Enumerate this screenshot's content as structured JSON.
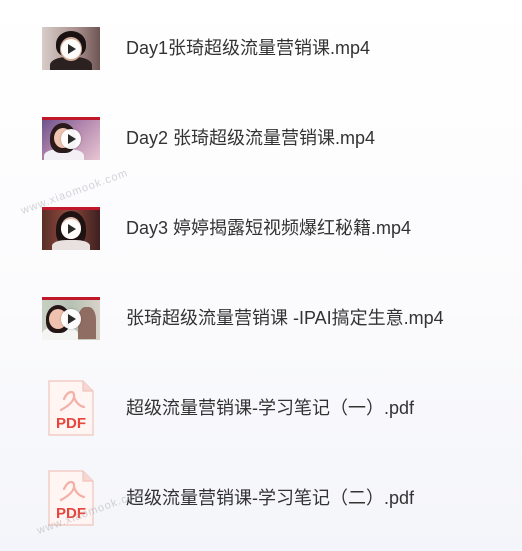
{
  "files": [
    {
      "name": "Day1张琦超级流量营销课.mp4",
      "type": "video"
    },
    {
      "name": "Day2 张琦超级流量营销课.mp4",
      "type": "video"
    },
    {
      "name": "Day3 婷婷揭露短视频爆红秘籍.mp4",
      "type": "video"
    },
    {
      "name": "张琦超级流量营销课 -IPAI搞定生意.mp4",
      "type": "video"
    },
    {
      "name": "超级流量营销课-学习笔记（一）.pdf",
      "type": "pdf"
    },
    {
      "name": "超级流量营销课-学习笔记（二）.pdf",
      "type": "pdf"
    }
  ],
  "pdf_icon": {
    "label": "PDF",
    "color": "#e8453c"
  },
  "watermark": "www.xiaomook.com"
}
